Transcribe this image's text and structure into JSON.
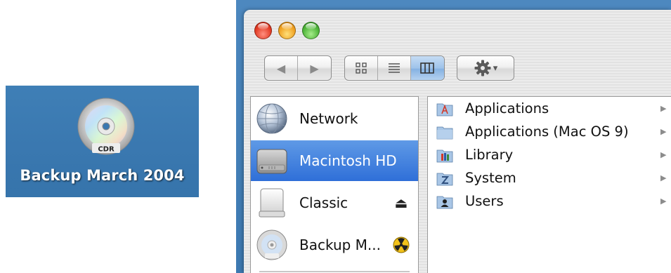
{
  "desktop_icon": {
    "disc_label": "CDR",
    "label": "Backup March 2004",
    "icon": "cdr-disc-icon"
  },
  "window": {
    "toolbar": {
      "back_icon": "back-arrow-icon",
      "forward_icon": "forward-arrow-icon",
      "back_glyph": "◀",
      "forward_glyph": "▶",
      "views": [
        {
          "name": "icon-view-icon",
          "active": false
        },
        {
          "name": "list-view-icon",
          "active": false
        },
        {
          "name": "column-view-icon",
          "active": true
        }
      ],
      "action_icon": "gear-icon",
      "action_glyph": "▾"
    },
    "sidebar": {
      "items": [
        {
          "label": "Network",
          "icon": "network-globe-icon",
          "selected": false,
          "badge": ""
        },
        {
          "label": "Macintosh HD",
          "icon": "hard-drive-icon",
          "selected": true,
          "badge": ""
        },
        {
          "label": "Classic",
          "icon": "drive-icon",
          "selected": false,
          "badge": "eject-icon"
        },
        {
          "label": "Backup M...",
          "icon": "cdr-disc-icon",
          "selected": false,
          "badge": "burn-icon"
        }
      ],
      "eject_glyph": "⏏"
    },
    "column": {
      "items": [
        {
          "label": "Applications",
          "icon": "applications-folder-icon"
        },
        {
          "label": "Applications (Mac OS 9)",
          "icon": "folder-icon"
        },
        {
          "label": "Library",
          "icon": "library-folder-icon"
        },
        {
          "label": "System",
          "icon": "system-folder-icon"
        },
        {
          "label": "Users",
          "icon": "users-folder-icon"
        }
      ],
      "arrow_glyph": "▶"
    }
  },
  "colors": {
    "desktop_blue": "#3a78b0",
    "selection_blue": "#2f6fd8",
    "close_red": "#e23a24",
    "minimize_yellow": "#f0a020",
    "zoom_green": "#4db438"
  }
}
